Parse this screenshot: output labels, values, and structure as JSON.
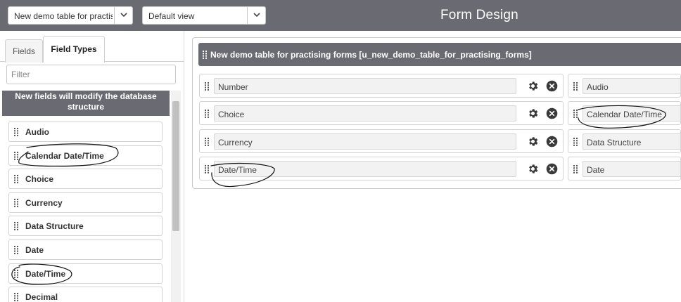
{
  "topbar": {
    "table_select_value": "New demo table for practising forms",
    "view_select_value": "Default view",
    "title": "Form Design"
  },
  "left_panel": {
    "tabs": [
      {
        "label": "Fields",
        "active": false
      },
      {
        "label": "Field Types",
        "active": true
      }
    ],
    "filter_placeholder": "Filter",
    "notice": "New fields will modify the database structure",
    "field_types": [
      {
        "label": "Audio"
      },
      {
        "label": "Calendar Date/Time"
      },
      {
        "label": "Choice"
      },
      {
        "label": "Currency"
      },
      {
        "label": "Data Structure"
      },
      {
        "label": "Date"
      },
      {
        "label": "Date/Time"
      },
      {
        "label": "Decimal"
      }
    ]
  },
  "form": {
    "section_title": "New demo table for practising forms [u_new_demo_table_for_practising_forms]",
    "left_column": [
      {
        "label": "Number"
      },
      {
        "label": "Choice"
      },
      {
        "label": "Currency"
      },
      {
        "label": "Date/Time"
      }
    ],
    "right_column": [
      {
        "label": "Audio"
      },
      {
        "label": "Calendar Date/Time"
      },
      {
        "label": "Data Structure"
      },
      {
        "label": "Date"
      }
    ]
  },
  "icons": {
    "grip": "drag-handle-icon",
    "gear": "gear-icon",
    "close": "close-circle-icon",
    "chevron": "chevron-down-icon"
  },
  "colors": {
    "header_bar": "#6a6a72",
    "icon_dark": "#3a3a3a",
    "field_background": "#f2f2f2"
  }
}
